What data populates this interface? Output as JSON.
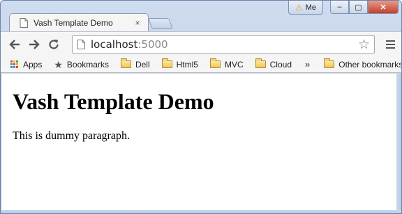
{
  "tab": {
    "title": "Vash Template Demo",
    "close_label": "×"
  },
  "window": {
    "profile_label": "Me",
    "minimize": "–",
    "maximize": "▢",
    "close": "✕"
  },
  "toolbar": {
    "url_host": "localhost",
    "url_port": ":5000"
  },
  "bookmarks": {
    "apps": "Apps",
    "bookmarks": "Bookmarks",
    "folders": [
      "Dell",
      "Html5",
      "MVC",
      "Cloud"
    ],
    "more": "»",
    "other": "Other bookmarks"
  },
  "page": {
    "heading": "Vash Template Demo",
    "paragraph": "This is dummy paragraph."
  },
  "colors": {
    "apps_grid": [
      "#e94235",
      "#f3b400",
      "#34a853",
      "#4285f4"
    ]
  }
}
